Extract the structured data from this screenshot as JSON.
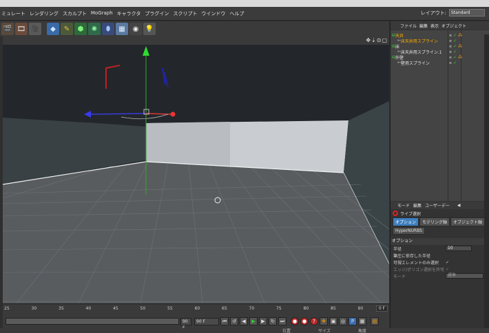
{
  "menu": {
    "items": [
      "ミュレート",
      "レンダリング",
      "スカルプト",
      "MoGraph",
      "キャラクタ",
      "プラグイン",
      "スクリプト",
      "ウインドウ",
      "ヘルプ"
    ]
  },
  "layout": {
    "label": "レイアウト:",
    "value": "Standard"
  },
  "toolbar": {
    "icons": [
      "render-view-icon",
      "render-picture-viewer-icon",
      "render-settings-icon",
      "cube-icon",
      "pen-spline-icon",
      "subdivision-icon",
      "array-icon",
      "deformer-icon",
      "floor-icon",
      "camera-icon",
      "light-icon"
    ]
  },
  "viewport": {
    "nav_icons": "✥⇣⊙▢"
  },
  "timeline": {
    "ticks": [
      "25",
      "30",
      "35",
      "40",
      "45",
      "50",
      "55",
      "60",
      "65",
      "70",
      "75",
      "80",
      "85",
      "90"
    ],
    "current_frame": "0 F",
    "start_field": "90 F",
    "end_field": "90 F"
  },
  "coord_labels": [
    "位置",
    "サイズ",
    "角度"
  ],
  "object_manager": {
    "menu": [
      "ファイル",
      "編集",
      "表示",
      "オブジェクト"
    ],
    "rows": [
      {
        "name": "天井",
        "indent": 0,
        "selected": true
      },
      {
        "name": "床天井用スプライン",
        "indent": 1,
        "selected": true
      },
      {
        "name": "床",
        "indent": 0,
        "selected": false
      },
      {
        "name": "床天井用スプライン.1",
        "indent": 1,
        "selected": false
      },
      {
        "name": "外壁",
        "indent": 0,
        "selected": false
      },
      {
        "name": "壁用スプライン",
        "indent": 1,
        "selected": false
      }
    ]
  },
  "attributes": {
    "menu": [
      "モード",
      "編集",
      "ユーザーデー"
    ],
    "title": "ライブ選択",
    "tabs": [
      {
        "label": "オプション",
        "active": true
      },
      {
        "label": "モデリング軸",
        "active": false
      },
      {
        "label": "オブジェクト軸",
        "active": false
      },
      {
        "label": "HyperNURBS",
        "active": false
      }
    ],
    "section": "オプション",
    "props": {
      "radius_label": "半径",
      "radius_value": "10",
      "pressure_label": "筆圧に依存した半径",
      "visible_only_label": "可視エレメントのみ選択",
      "visible_only_check": "✓",
      "edge_label": "エッジ/ポリゴン選択を許可",
      "edge_check": "✓",
      "mode_label": "モード",
      "mode_value": "標準"
    }
  }
}
